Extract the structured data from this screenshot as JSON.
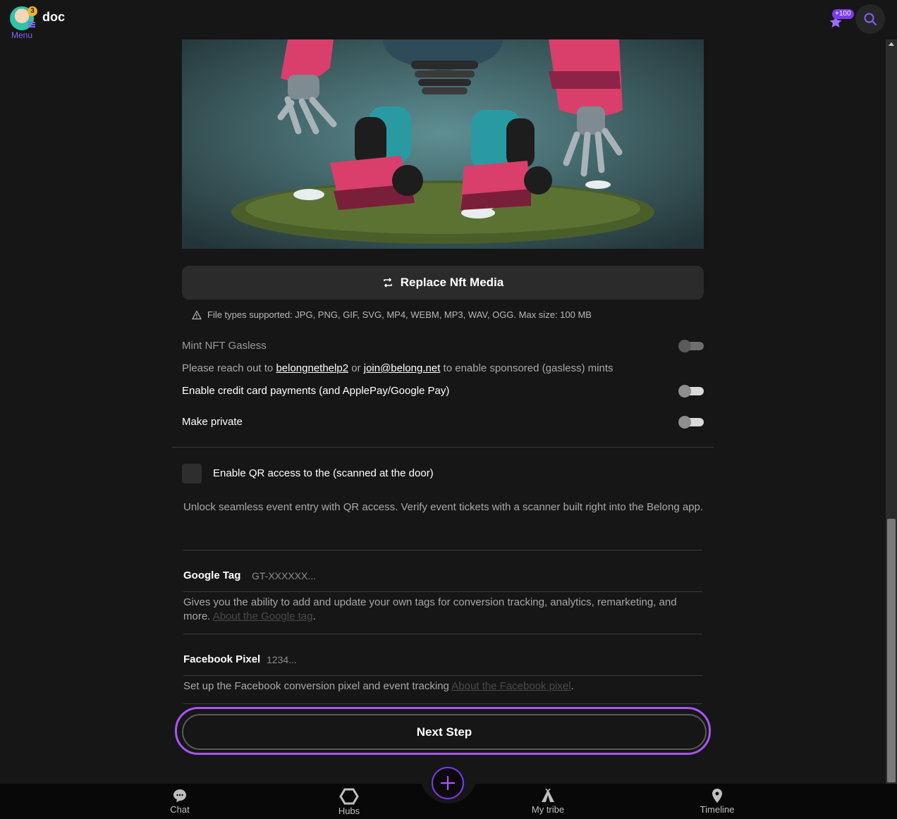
{
  "header": {
    "app_title": "doc",
    "menu_label": "Menu",
    "notification_count": "3",
    "points_badge": "+100"
  },
  "media": {
    "image_name": "robot-nft-image"
  },
  "replace_media": {
    "label": "Replace Nft Media"
  },
  "file_info": {
    "text": "File types supported: JPG, PNG, GIF, SVG, MP4, WEBM, MP3, WAV, OGG. Max size: 100 MB"
  },
  "settings": {
    "mint_gasless": {
      "label": "Mint NFT Gasless",
      "enabled": false,
      "disabled": true
    },
    "gasless_note": {
      "prefix": "Please reach out to",
      "link1": "belongnethelp2",
      "middle": "or",
      "link2": "join@belong.net",
      "suffix": "to enable sponsored (gasless) mints"
    },
    "credit_card": {
      "label": "Enable credit card payments (and ApplePay/Google Pay)",
      "enabled": false
    },
    "private": {
      "label": "Make private",
      "enabled": false
    }
  },
  "qr_access": {
    "label": "Enable QR access to the (scanned at the door)",
    "checked": false,
    "description": "Unlock seamless event entry with QR access. Verify event tickets with a scanner built right into the Belong app."
  },
  "google_tag": {
    "label": "Google Tag",
    "placeholder": "GT-XXXXXX...",
    "description": "Gives you the ability to add and update your own tags for conversion tracking, analytics, remarketing, and more.",
    "link": "About the Google tag",
    "end": "."
  },
  "facebook_pixel": {
    "label": "Facebook Pixel",
    "placeholder": "1234...",
    "description": "Set up the Facebook conversion pixel and event tracking",
    "link": "About the Facebook pixel",
    "end": "."
  },
  "next_step": {
    "label": "Next Step"
  },
  "bottom_nav": {
    "chat": "Chat",
    "hubs": "Hubs",
    "tribe": "My tribe",
    "timeline": "Timeline"
  },
  "colors": {
    "background": "#161616",
    "accent": "#a855f7",
    "brand_purple": "#7c3aed"
  }
}
